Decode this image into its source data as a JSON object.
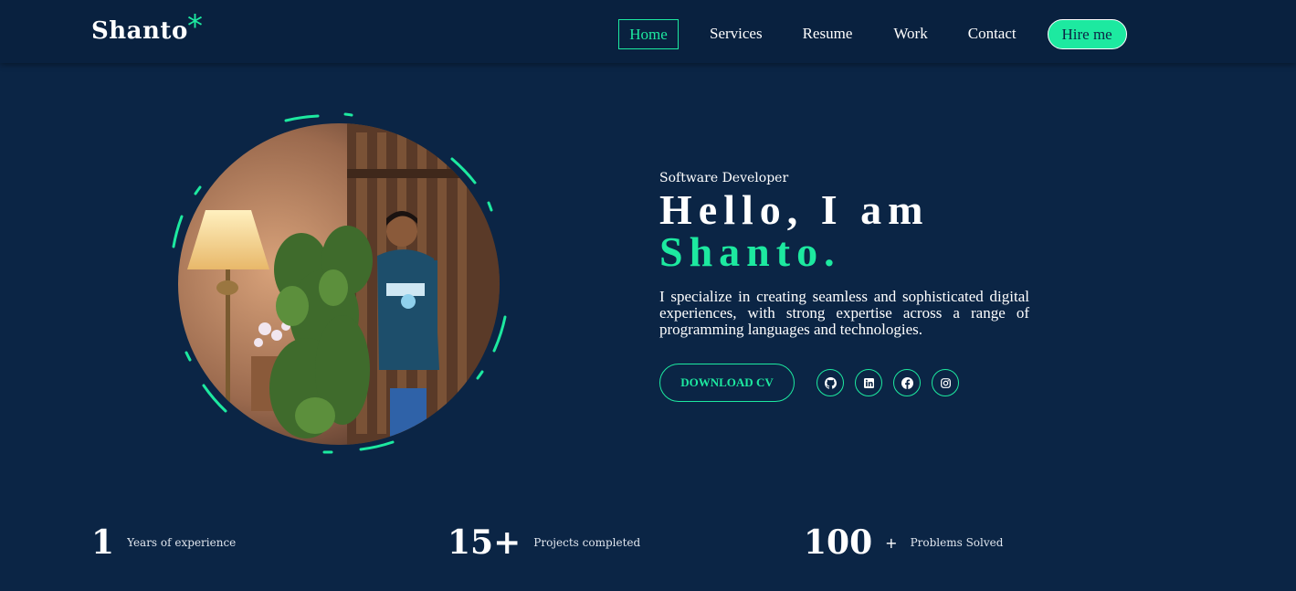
{
  "nav": {
    "logo": "Shanto",
    "logo_mark": "*",
    "links": [
      "Home",
      "Services",
      "Resume",
      "Work",
      "Contact"
    ],
    "cta": "Hire me"
  },
  "hero": {
    "role": "Software Developer",
    "greeting": "Hello, I am",
    "name": "Shanto.",
    "description": "I specialize in creating seamless and sophisticated digital experiences, with strong expertise across a range of programming languages and technologies.",
    "download_label": "DOWNLOAD CV",
    "social_icons": [
      "github-icon",
      "linkedin-icon",
      "facebook-icon",
      "instagram-icon"
    ]
  },
  "stats": [
    {
      "value": "1",
      "label": "Years of experience"
    },
    {
      "value": "15+",
      "label": "Projects completed"
    },
    {
      "value": "100",
      "suffix": "+",
      "label": "Problems Solved"
    }
  ],
  "colors": {
    "background": "#0b2545",
    "navbar": "#09213f",
    "accent": "#1de9a0",
    "text": "#ffffff"
  }
}
